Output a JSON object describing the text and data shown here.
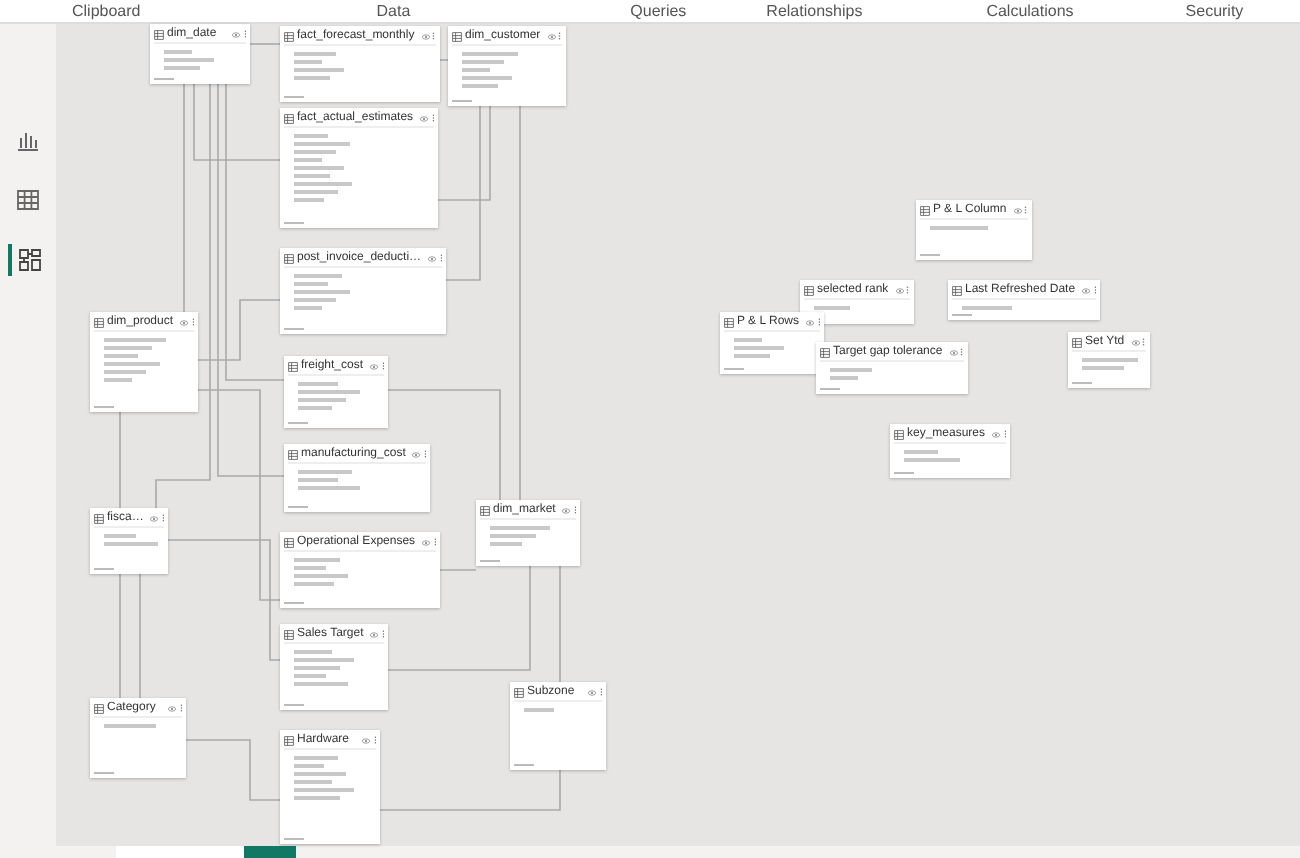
{
  "ribbon_groups": [
    "Clipboard",
    "Data",
    "Queries",
    "Relationships",
    "Calculations",
    "Security"
  ],
  "sidebar": [
    {
      "kind": "report",
      "selected": false
    },
    {
      "kind": "table",
      "selected": false
    },
    {
      "kind": "model",
      "selected": true
    }
  ],
  "tables": [
    {
      "name": "dim_date"
    },
    {
      "name": "fact_forecast_monthly"
    },
    {
      "name": "dim_customer"
    },
    {
      "name": "fact_actual_estimates"
    },
    {
      "name": "post_invoice_deducti…"
    },
    {
      "name": "dim_product"
    },
    {
      "name": "freight_cost"
    },
    {
      "name": "manufacturing_cost"
    },
    {
      "name": "fisca…"
    },
    {
      "name": "Operational Expenses"
    },
    {
      "name": "dim_market"
    },
    {
      "name": "Sales Target"
    },
    {
      "name": "Category"
    },
    {
      "name": "Subzone"
    },
    {
      "name": "Hardware"
    },
    {
      "name": "P & L Column"
    },
    {
      "name": "selected rank"
    },
    {
      "name": "Last Refreshed Date"
    },
    {
      "name": "P & L Rows"
    },
    {
      "name": "Target gap tolerance"
    },
    {
      "name": "Set Ytd"
    },
    {
      "name": "key_measures"
    }
  ]
}
